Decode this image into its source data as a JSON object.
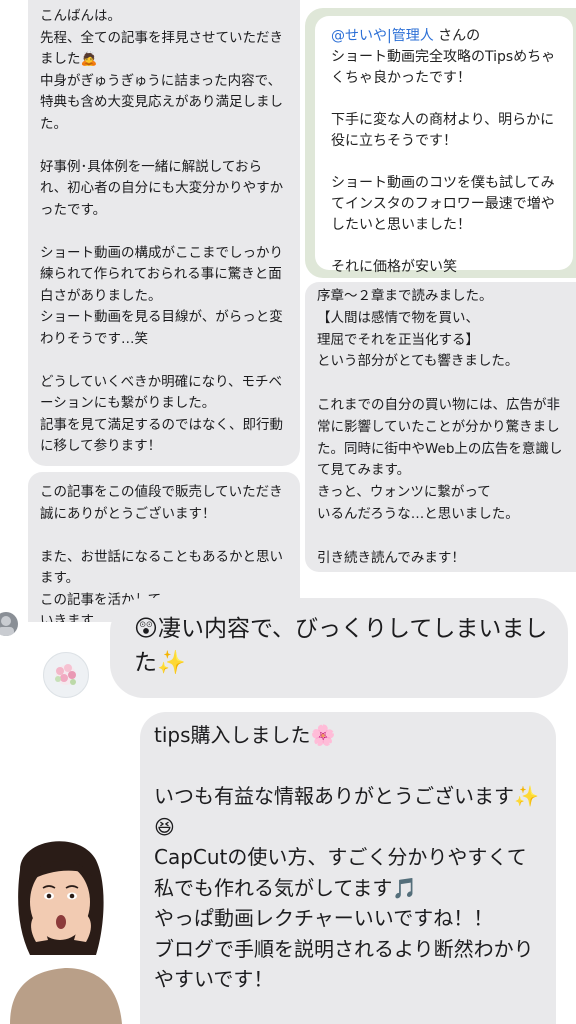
{
  "messages": {
    "top_left": "こんばんは。\n先程、全ての記事を拝見させていただきました🙇\n中身がぎゅうぎゅうに詰まった内容で、特典も含め大変見応えがあり満足しました。\n\n好事例･具体例を一緒に解説しておられ、初心者の自分にも大変分かりやすかったです。\n\nショート動画の構成がここまでしっかり練られて作られておられる事に驚きと面白さがありました。\nショート動画を見る目線が、がらっと変わりそうです…笑\n\nどうしていくべきか明確になり、モチベーションにも繋がりました。\n記事を見て満足するのではなく、即行動に移して参ります！",
    "mid_left": "この記事をこの値段で販売していただき誠にありがとうございます！\n\nまた、お世話になることもあるかと思います。\nこの記事を活かして\nいきます",
    "right_top": {
      "mention": "@せいや|管理人",
      "mention_suffix": " さんの\nショート動画完全攻略のTipsめちゃくちゃ良かったです！\n\n下手に変な人の商材より、明らかに役に立ちそうです！\n\nショート動画のコツを僕も試してみてインスタのフォロワー最速で増やしたいと思いました！\n\nそれに価格が安い笑"
    },
    "right_mid": "序章〜２章まで読みました。\n【人間は感情で物を買い、\n理屈でそれを正当化する】\nという部分がとても響きました。\n\nこれまでの自分の買い物には、広告が非常に影響していたことが分かり驚きました。同時に街中やWeb上の広告を意識して見てみます。\nきっと、ウォンツに繋がって\nいるんだろうな…と思いました。\n\n引き続き読んでみます！",
    "amazed": "😲凄い内容で、びっくりしてしまいました✨",
    "tips": "tips購入しました🌸\n\nいつも有益な情報ありがとうございます✨😆\nCapCutの使い方、すごく分かりやすくて私でも作れる気がしてます🎵\nやっぱ動画レクチャーいいですね！！\nブログで手順を説明されるより断然わかりやすいです！"
  },
  "colors": {
    "bubble": "#e9e9eb",
    "panel_green": "#dfe7d8",
    "mention": "#2b6fd6"
  }
}
